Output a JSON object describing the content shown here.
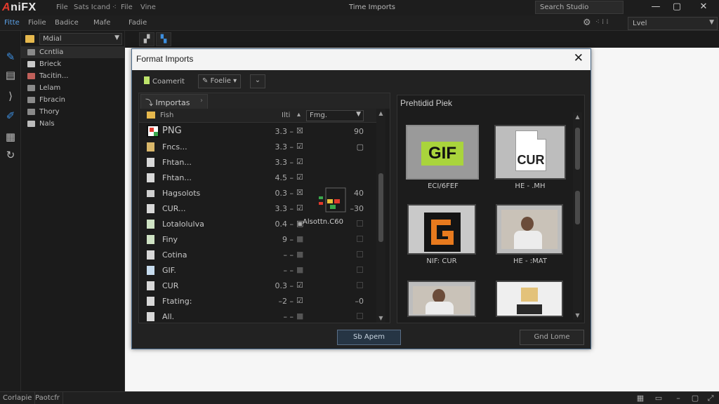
{
  "app": {
    "logo_prefix": "A",
    "logo_text": "niFX",
    "title": "Time Imports",
    "menu_items": [
      "File",
      "Sats Icand",
      "File",
      "Vine"
    ],
    "search_placeholder": "Search Studio",
    "window_controls": [
      "—",
      "▢",
      "✕"
    ]
  },
  "menubar": {
    "items": [
      "Fitte",
      "Fiolie",
      "Badice",
      "Mafe",
      "Fadie"
    ],
    "level_select": "Lvel"
  },
  "left_panel": {
    "combo_value": "Mdial",
    "items": [
      "Ccntlia",
      "Brieck",
      "Tacitin...",
      "Lelam",
      "Fbracin",
      "Thory",
      "Nals"
    ]
  },
  "dialog": {
    "title": "Format Imports",
    "toolbar": {
      "document_button": "Coamerit",
      "filter_button": "Foelie",
      "filter_arrow": "▾",
      "expand_icon": "⌄"
    },
    "file_list": {
      "tab_label": "Importas",
      "header_name": "Fish",
      "header_size": "Ilti",
      "format_combo": "Fmg.",
      "rows": [
        {
          "name": "PNG",
          "size": "3.3 –",
          "check": "☒",
          "value": "90"
        },
        {
          "name": "Fncs...",
          "size": "3.3 –",
          "check": "☑",
          "value": "▢"
        },
        {
          "name": "Fhtan...",
          "size": "3.3 –",
          "check": "☑",
          "value": ""
        },
        {
          "name": "Fhtan...",
          "size": "4.5 –",
          "check": "☑",
          "value": ""
        },
        {
          "name": "Hagsolots",
          "size": "0.3 –",
          "check": "☒",
          "value": "40"
        },
        {
          "name": "CUR...",
          "size": "3.3 –",
          "check": "☑",
          "value": "–30"
        },
        {
          "name": "Lotalolulva",
          "size": "0.4 –",
          "check": "▣",
          "value": ""
        },
        {
          "name": "Finy",
          "size": "9 –",
          "check": "■",
          "value": ""
        },
        {
          "name": "Cotina",
          "size": "– –",
          "check": "■",
          "value": ""
        },
        {
          "name": "GIF.",
          "size": "– –",
          "check": "■",
          "value": ""
        },
        {
          "name": "CUR",
          "size": "0.3 –",
          "check": "☑",
          "value": ""
        },
        {
          "name": "Ftating:",
          "size": "–2 –",
          "check": "☑",
          "value": "–0"
        },
        {
          "name": "All.",
          "size": "– –",
          "check": "■",
          "value": ""
        }
      ],
      "anim_label": "Alsottn.C60"
    },
    "preview": {
      "title": "Prehtidid Piek",
      "thumbnails": [
        {
          "badge": "GIF",
          "label": "ECI/6FEF"
        },
        {
          "badge": "CUR",
          "label": "HE - .MH"
        },
        {
          "badge": "",
          "label": "NIF: CUR"
        },
        {
          "badge": "",
          "label": "HE - :MAT"
        },
        {
          "badge": "",
          "label": ""
        },
        {
          "badge": "",
          "label": ""
        }
      ]
    },
    "buttons": {
      "import": "Sb Apem",
      "cancel": "Gnd Lome"
    }
  },
  "statusbar": {
    "tabs": [
      "Corlapie",
      "Paotcfr"
    ]
  },
  "colors": {
    "accent": "#3d8fe0",
    "brand_red": "#e23a2c",
    "gif_badge": "#a9d43c"
  }
}
